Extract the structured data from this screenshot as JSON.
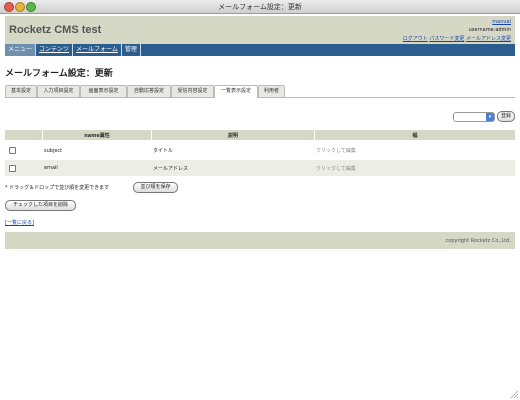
{
  "window": {
    "title": "メールフォーム設定：更新"
  },
  "header": {
    "site_name": "Rocketz CMS test",
    "manual_link": "manual",
    "username": "username:admin",
    "links": [
      "ログアウト",
      "パスワード変更",
      "メールアドレス変更"
    ]
  },
  "nav": [
    "メニュー",
    "コンテンツ",
    "メールフォーム",
    "管理"
  ],
  "page_title": "メールフォーム設定：更新",
  "tabs": [
    "基本設定",
    "入力項目設定",
    "画面表示設定",
    "自動応答設定",
    "受信内容設定",
    "一覧表示設定",
    "利用者"
  ],
  "active_tab": "一覧表示設定",
  "toolbar": {
    "select_value": "",
    "register_button": "登録"
  },
  "table": {
    "headers": [
      "name属性",
      "説明",
      "幅"
    ],
    "rows": [
      {
        "name": "subject",
        "desc": "タイトル",
        "width": "クリックして編集"
      },
      {
        "name": "email",
        "desc": "メールアドレス",
        "width": "クリックして編集"
      }
    ]
  },
  "hint": "* ドラッグ＆ドロップで並び順を変更できます",
  "save_order_button": "並び順を保存",
  "delete_checked_button": "チェックした項目を削除",
  "back_link": "[一覧に戻る]",
  "footer": {
    "copyright": "copyright Rocketz Co.,Ltd."
  },
  "colors": {
    "header_bg": "#d6d8c6",
    "nav_bg": "#2c5d8f",
    "link": "#1a44a8"
  }
}
